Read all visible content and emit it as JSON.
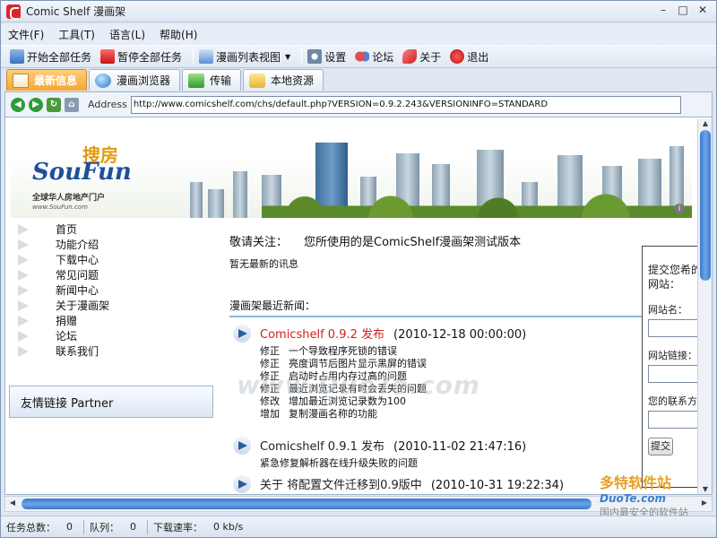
{
  "window": {
    "title": "Comic Shelf 漫画架",
    "controls": [
      "–",
      "□",
      "✕"
    ]
  },
  "menu": [
    {
      "label": "文件(F)"
    },
    {
      "label": "工具(T)"
    },
    {
      "label": "语言(L)"
    },
    {
      "label": "帮助(H)"
    }
  ],
  "toolbar": {
    "start_all": "开始全部任务",
    "pause_all": "暂停全部任务",
    "list_view": "漫画列表视图",
    "settings": "设置",
    "forum": "论坛",
    "about": "关于",
    "exit": "退出"
  },
  "tabs": [
    {
      "label": "最新信息",
      "active": true
    },
    {
      "label": "漫画浏览器",
      "active": false
    },
    {
      "label": "传输",
      "active": false
    },
    {
      "label": "本地资源",
      "active": false
    }
  ],
  "address": {
    "label": "Address",
    "url": "http://www.comicshelf.com/chs/default.php?VERSION=0.9.2.243&VERSIONINFO=STANDARD"
  },
  "banner": {
    "logo_cn": "搜房",
    "logo_en": "SouFun",
    "logo_sub": "全球华人房地产门户",
    "logo_url": "www.SouFun.com"
  },
  "sidenav": [
    "首页",
    "功能介绍",
    "下载中心",
    "常见问题",
    "新闻中心",
    "关于漫画架",
    "捐赠",
    "论坛",
    "联系我们"
  ],
  "partner": "友情链接 Partner",
  "notice": {
    "label": "敬请关注：",
    "text": "您所使用的是ComicShelf漫画架测试版本"
  },
  "no_news": "暂无最新的讯息",
  "recent_title": "漫画架最近新闻：",
  "news": [
    {
      "title": "Comicshelf 0.9.2 发布",
      "date": "(2010-12-18 00:00:00)",
      "lines": [
        {
          "kw": "修正",
          "text": "一个导致程序死锁的错误"
        },
        {
          "kw": "修正",
          "text": "亮度调节后图片显示黑屏的错误"
        },
        {
          "kw": "修正",
          "text": "启动时占用内存过高的问题"
        },
        {
          "kw": "修正",
          "text": "最近浏览记录有时会丢失的问题"
        },
        {
          "kw": "修改",
          "text": "增加最近浏览记录数为100"
        },
        {
          "kw": "增加",
          "text": "复制漫画名称的功能"
        }
      ]
    },
    {
      "title": "Comicshelf 0.9.1 发布",
      "date": "(2010-11-02 21:47:16)",
      "lines": [
        {
          "kw": "",
          "text": "紧急修复解析器在线升级失败的问题"
        }
      ]
    },
    {
      "title": "关于 将配置文件迁移到0.9版中",
      "date": "(2010-10-31 19:22:34)",
      "lines": []
    }
  ],
  "submit_form": {
    "title": "提交您希的网站：",
    "site_name_label": "网站名：",
    "site_link_label": "网站链接：",
    "contact_label": "您的联系方",
    "submit_button": "提交"
  },
  "status": {
    "total_label": "任务总数：",
    "total_value": "0",
    "queue_label": "队列：",
    "queue_value": "0",
    "speed_label": "下载速率：",
    "speed_value": "0 kb/s"
  },
  "watermarks": {
    "center": "www.DuoTe.com",
    "corner_big": "多特软件站",
    "corner_mid": "DuoTe.com",
    "corner_small": "国内最安全的软件站"
  },
  "colors": {
    "active_tab": "#f5a733",
    "news_red": "#d42020",
    "scroll_blue": "#3f78c8"
  }
}
